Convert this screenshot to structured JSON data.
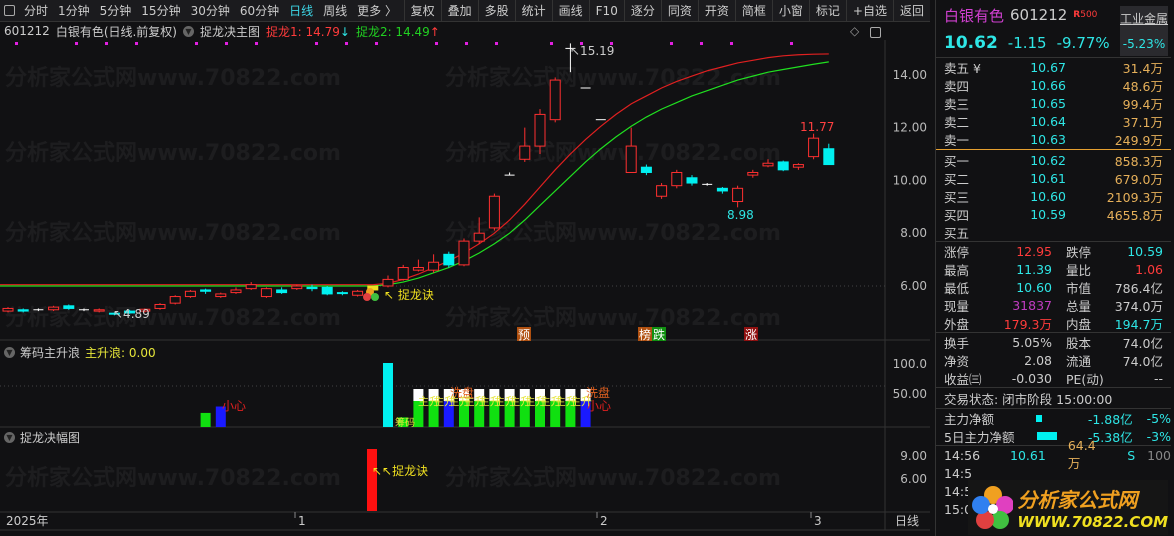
{
  "toolbar": {
    "periods": [
      "分时",
      "1分钟",
      "5分钟",
      "15分钟",
      "30分钟",
      "60分钟",
      "日线",
      "周线",
      "更多 〉"
    ],
    "active": "日线",
    "buttons": [
      "复权",
      "叠加",
      "多股",
      "统计",
      "画线",
      "F10",
      "逐分",
      "同资",
      "开资",
      "简框",
      "小窗",
      "标记",
      "+自选",
      "返回"
    ]
  },
  "info": {
    "code": "601212",
    "name": "白银有色(日线.前复权)",
    "indicator": "捉龙决主图",
    "ma1_label": "捉龙1: 14.79",
    "ma1_arrow": "↓",
    "ma2_label": "捉龙2: 14.49",
    "ma2_arrow": "↑"
  },
  "panels": {
    "p2_title": "筹码主升浪",
    "p2_value": "主升浪: 0.00",
    "p3_title": "捉龙决幅图"
  },
  "watermark": "分析家公式网www.70822.com",
  "chart_data": {
    "type": "candlestick",
    "price_axis": [
      "14.00",
      "12.00",
      "10.00",
      "8.00",
      "6.00"
    ],
    "price_ticks": [
      14,
      12,
      10,
      8,
      6
    ],
    "ylim": [
      4.3,
      15.8
    ],
    "candles": [
      [
        5.05,
        5.15,
        5.2,
        5.0
      ],
      [
        5.1,
        5.05,
        5.15,
        5.0
      ],
      [
        5.1,
        5.1,
        5.15,
        5.05
      ],
      [
        5.1,
        5.2,
        5.25,
        5.05
      ],
      [
        5.25,
        5.15,
        5.3,
        5.1
      ],
      [
        5.1,
        5.1,
        5.15,
        5.05
      ],
      [
        5.05,
        5.1,
        5.15,
        5.0
      ],
      [
        4.97,
        4.95,
        5.0,
        4.89
      ],
      [
        5.05,
        4.98,
        5.1,
        4.95
      ],
      [
        5.05,
        5.12,
        5.15,
        5.0
      ],
      [
        5.15,
        5.3,
        5.35,
        5.1
      ],
      [
        5.35,
        5.6,
        5.65,
        5.3
      ],
      [
        5.6,
        5.8,
        5.85,
        5.55
      ],
      [
        5.85,
        5.8,
        5.9,
        5.7
      ],
      [
        5.6,
        5.7,
        5.75,
        5.55
      ],
      [
        5.75,
        5.85,
        5.95,
        5.7
      ],
      [
        5.9,
        6.05,
        6.15,
        5.85
      ],
      [
        5.6,
        5.9,
        5.95,
        5.55
      ],
      [
        5.85,
        5.75,
        5.95,
        5.7
      ],
      [
        5.9,
        6.0,
        6.05,
        5.85
      ],
      [
        5.95,
        5.9,
        6.05,
        5.8
      ],
      [
        5.95,
        5.7,
        6.0,
        5.65
      ],
      [
        5.75,
        5.72,
        5.8,
        5.65
      ],
      [
        5.65,
        5.8,
        5.85,
        5.6
      ],
      [
        5.85,
        6.0,
        6.0,
        5.85
      ],
      [
        6.0,
        6.25,
        6.4,
        5.95
      ],
      [
        6.25,
        6.7,
        6.8,
        6.2
      ],
      [
        6.6,
        6.7,
        7.0,
        6.55
      ],
      [
        6.6,
        6.9,
        7.2,
        6.5
      ],
      [
        7.2,
        6.8,
        7.3,
        6.7
      ],
      [
        6.8,
        7.7,
        7.8,
        6.75
      ],
      [
        7.7,
        8.0,
        8.6,
        7.6
      ],
      [
        8.2,
        9.4,
        9.5,
        8.1
      ],
      [
        10.2,
        10.2,
        10.3,
        10.2
      ],
      [
        10.8,
        11.3,
        12.0,
        10.7
      ],
      [
        11.3,
        12.5,
        12.7,
        11.0
      ],
      [
        12.3,
        13.8,
        13.9,
        12.2
      ],
      [
        15.0,
        15.0,
        15.19,
        14.1
      ],
      [
        13.5,
        13.5,
        13.5,
        13.5
      ],
      [
        12.3,
        12.3,
        12.3,
        12.3
      ],
      null,
      [
        10.3,
        11.3,
        12.0,
        10.3
      ],
      [
        10.5,
        10.3,
        10.6,
        10.2
      ],
      [
        9.4,
        9.8,
        9.9,
        9.3
      ],
      [
        9.8,
        10.3,
        10.4,
        9.7
      ],
      [
        10.1,
        9.9,
        10.2,
        9.8
      ],
      [
        9.85,
        9.85,
        9.9,
        9.8
      ],
      [
        9.7,
        9.6,
        9.75,
        9.5
      ],
      [
        9.2,
        9.7,
        9.8,
        8.98
      ],
      [
        10.2,
        10.3,
        10.4,
        10.1
      ],
      [
        10.55,
        10.65,
        10.8,
        10.5
      ],
      [
        10.7,
        10.4,
        10.75,
        10.35
      ],
      [
        10.5,
        10.6,
        10.65,
        10.4
      ],
      [
        10.9,
        11.6,
        11.77,
        10.8
      ],
      [
        11.2,
        10.6,
        11.39,
        10.6
      ]
    ],
    "ma1": [
      6.05,
      6.05,
      6.05,
      6.05,
      6.05,
      6.05,
      6.05,
      6.05,
      6.05,
      6.05,
      6.05,
      6.05,
      6.05,
      6.05,
      6.05,
      6.05,
      6.05,
      6.05,
      6.05,
      6.05,
      6.05,
      6.05,
      6.05,
      6.05,
      6.05,
      6.1,
      6.25,
      6.45,
      6.7,
      6.95,
      7.25,
      7.6,
      8.0,
      8.5,
      9.1,
      9.75,
      10.4,
      11.0,
      11.55,
      12.05,
      12.5,
      12.9,
      13.2,
      13.5,
      13.75,
      13.95,
      14.15,
      14.3,
      14.45,
      14.55,
      14.65,
      14.72,
      14.76,
      14.78,
      14.79
    ],
    "ma2": [
      6.0,
      6.0,
      6.0,
      6.0,
      6.0,
      6.0,
      6.0,
      6.0,
      6.0,
      6.0,
      6.0,
      6.0,
      6.0,
      6.0,
      6.0,
      6.0,
      6.0,
      6.0,
      6.0,
      6.0,
      6.0,
      6.0,
      6.0,
      6.0,
      6.0,
      6.05,
      6.15,
      6.3,
      6.5,
      6.7,
      6.95,
      7.25,
      7.6,
      8.0,
      8.5,
      9.05,
      9.6,
      10.15,
      10.7,
      11.2,
      11.65,
      12.05,
      12.4,
      12.7,
      12.95,
      13.2,
      13.4,
      13.6,
      13.8,
      13.95,
      14.1,
      14.2,
      14.3,
      14.4,
      14.49
    ],
    "annotations": {
      "low": "4.89",
      "high": "15.19",
      "low2": "8.98",
      "high2": "11.77",
      "signal": "↖ 捉龙诀",
      "tags": [
        "预",
        "榜",
        "跌",
        "涨"
      ]
    },
    "p2_axis": [
      "100.0",
      "50.00"
    ],
    "p2_bars": [
      {
        "i": 13,
        "v": 22,
        "c": "#10e010"
      },
      {
        "i": 14,
        "v": 32,
        "c": "#1a1aff"
      },
      {
        "i": 25,
        "v": 100,
        "c": "#00f0f0"
      },
      {
        "i": 26,
        "v": 15,
        "c": "#10e010"
      },
      {
        "i": 27,
        "v": 40,
        "c": "#10e010"
      },
      {
        "i": 28,
        "v": 40,
        "c": "#10e010"
      },
      {
        "i": 29,
        "v": 40,
        "c": "#1a1aff"
      },
      {
        "i": 30,
        "v": 40,
        "c": "#10e010"
      },
      {
        "i": 31,
        "v": 40,
        "c": "#10e010"
      },
      {
        "i": 32,
        "v": 40,
        "c": "#10e010"
      },
      {
        "i": 33,
        "v": 40,
        "c": "#10e010"
      },
      {
        "i": 34,
        "v": 40,
        "c": "#10e010"
      },
      {
        "i": 35,
        "v": 40,
        "c": "#10e010"
      },
      {
        "i": 36,
        "v": 40,
        "c": "#10e010"
      },
      {
        "i": 37,
        "v": 40,
        "c": "#10e010"
      },
      {
        "i": 38,
        "v": 40,
        "c": "#1a1aff"
      }
    ],
    "p2_labels": {
      "caution": "小心",
      "wash": "洗盘",
      "rise": "主升",
      "chip": "筹码"
    },
    "p3_axis": [
      "9.00",
      "6.00"
    ],
    "p3_signal": "↖↖捉龙诀",
    "x_axis": {
      "year": "2025年",
      "months": [
        "1",
        "2",
        "3"
      ],
      "period": "日线"
    }
  },
  "quote": {
    "name": "白银有色",
    "code": "601212",
    "badge": "R",
    "badge_num": "500",
    "price": "10.62",
    "change": "-1.15",
    "pct": "-9.77%",
    "sector": "工业金属",
    "sector_pct": "-5.23%",
    "asks": [
      {
        "l": "卖五 ¥",
        "p": "10.67",
        "v": "31.4万"
      },
      {
        "l": "卖四",
        "p": "10.66",
        "v": "48.6万"
      },
      {
        "l": "卖三",
        "p": "10.65",
        "v": "99.4万"
      },
      {
        "l": "卖二",
        "p": "10.64",
        "v": "37.1万"
      },
      {
        "l": "卖一",
        "p": "10.63",
        "v": "249.9万"
      }
    ],
    "bids": [
      {
        "l": "买一",
        "p": "10.62",
        "v": "858.3万"
      },
      {
        "l": "买二",
        "p": "10.61",
        "v": "679.0万"
      },
      {
        "l": "买三",
        "p": "10.60",
        "v": "2109.3万"
      },
      {
        "l": "买四",
        "p": "10.59",
        "v": "4655.8万"
      },
      {
        "l": "买五",
        "p": "",
        "v": ""
      }
    ],
    "stats1": [
      [
        "涨停",
        "12.95",
        "跌停",
        "10.59"
      ],
      [
        "最高",
        "11.39",
        "量比",
        "1.06"
      ],
      [
        "最低",
        "10.60",
        "市值",
        "786.4亿"
      ],
      [
        "现量",
        "31837",
        "总量",
        "374.0万"
      ],
      [
        "外盘",
        "179.3万",
        "内盘",
        "194.7万"
      ]
    ],
    "stats2": [
      [
        "换手",
        "5.05%",
        "股本",
        "74.0亿"
      ],
      [
        "净资",
        "2.08",
        "流通",
        "74.0亿"
      ],
      [
        "收益㈢",
        "-0.030",
        "PE(动)",
        "--"
      ]
    ],
    "status": "交易状态: 闭市阶段 15:00:00",
    "flow": [
      {
        "l": "主力净额",
        "v": "-1.88亿",
        "p": "-5%"
      },
      {
        "l": "5日主力净额",
        "v": "-5.38亿",
        "p": "-3%"
      }
    ],
    "ticks": [
      {
        "t": "14:56",
        "p": "10.61",
        "v": "64.4万",
        "s": "S",
        "n": "100"
      },
      {
        "t": "14:5"
      },
      {
        "t": "14:5"
      },
      {
        "t": "15:0"
      }
    ],
    "logo_text": "分析家公式网",
    "logo_url": "WWW.70822.COM"
  }
}
